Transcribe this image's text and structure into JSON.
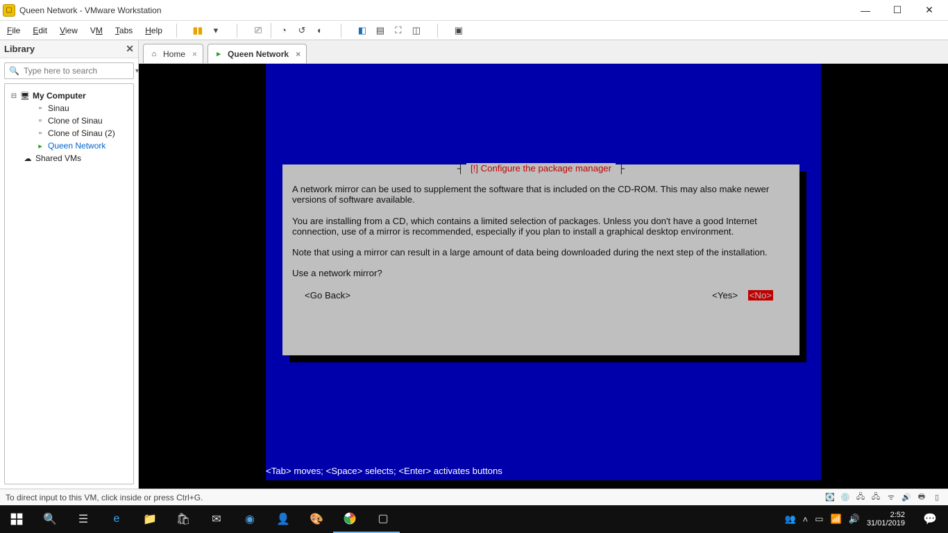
{
  "window": {
    "title": "Queen Network - VMware Workstation",
    "min": "—",
    "max": "☐",
    "close": "✕"
  },
  "menu": {
    "file": "File",
    "edit": "Edit",
    "view": "View",
    "vm": "VM",
    "tabs": "Tabs",
    "help": "Help"
  },
  "library": {
    "title": "Library",
    "search_placeholder": "Type here to search",
    "root": "My Computer",
    "items": [
      "Sinau",
      "Clone of Sinau",
      "Clone of Sinau (2)",
      "Queen Network"
    ],
    "shared": "Shared VMs"
  },
  "tabs": {
    "home": "Home",
    "active": "Queen Network"
  },
  "installer": {
    "title": "[!] Configure the package manager",
    "para1": "A network mirror can be used to supplement the software that is included on the CD-ROM. This may also make newer versions of software available.",
    "para2": "You are installing from a CD, which contains a limited selection of packages. Unless you don't have a good Internet connection, use of a mirror is recommended, especially if you plan to install a graphical desktop environment.",
    "para3": "Note that using a mirror can result in a large amount of data being downloaded during the next step of the installation.",
    "prompt": "Use a network mirror?",
    "go_back": "<Go Back>",
    "yes": "<Yes>",
    "no": "<No>",
    "hint": "<Tab> moves; <Space> selects; <Enter> activates buttons"
  },
  "statusbar": {
    "text": "To direct input to this VM, click inside or press Ctrl+G."
  },
  "taskbar": {
    "time": "2:52",
    "date": "31/01/2019"
  }
}
